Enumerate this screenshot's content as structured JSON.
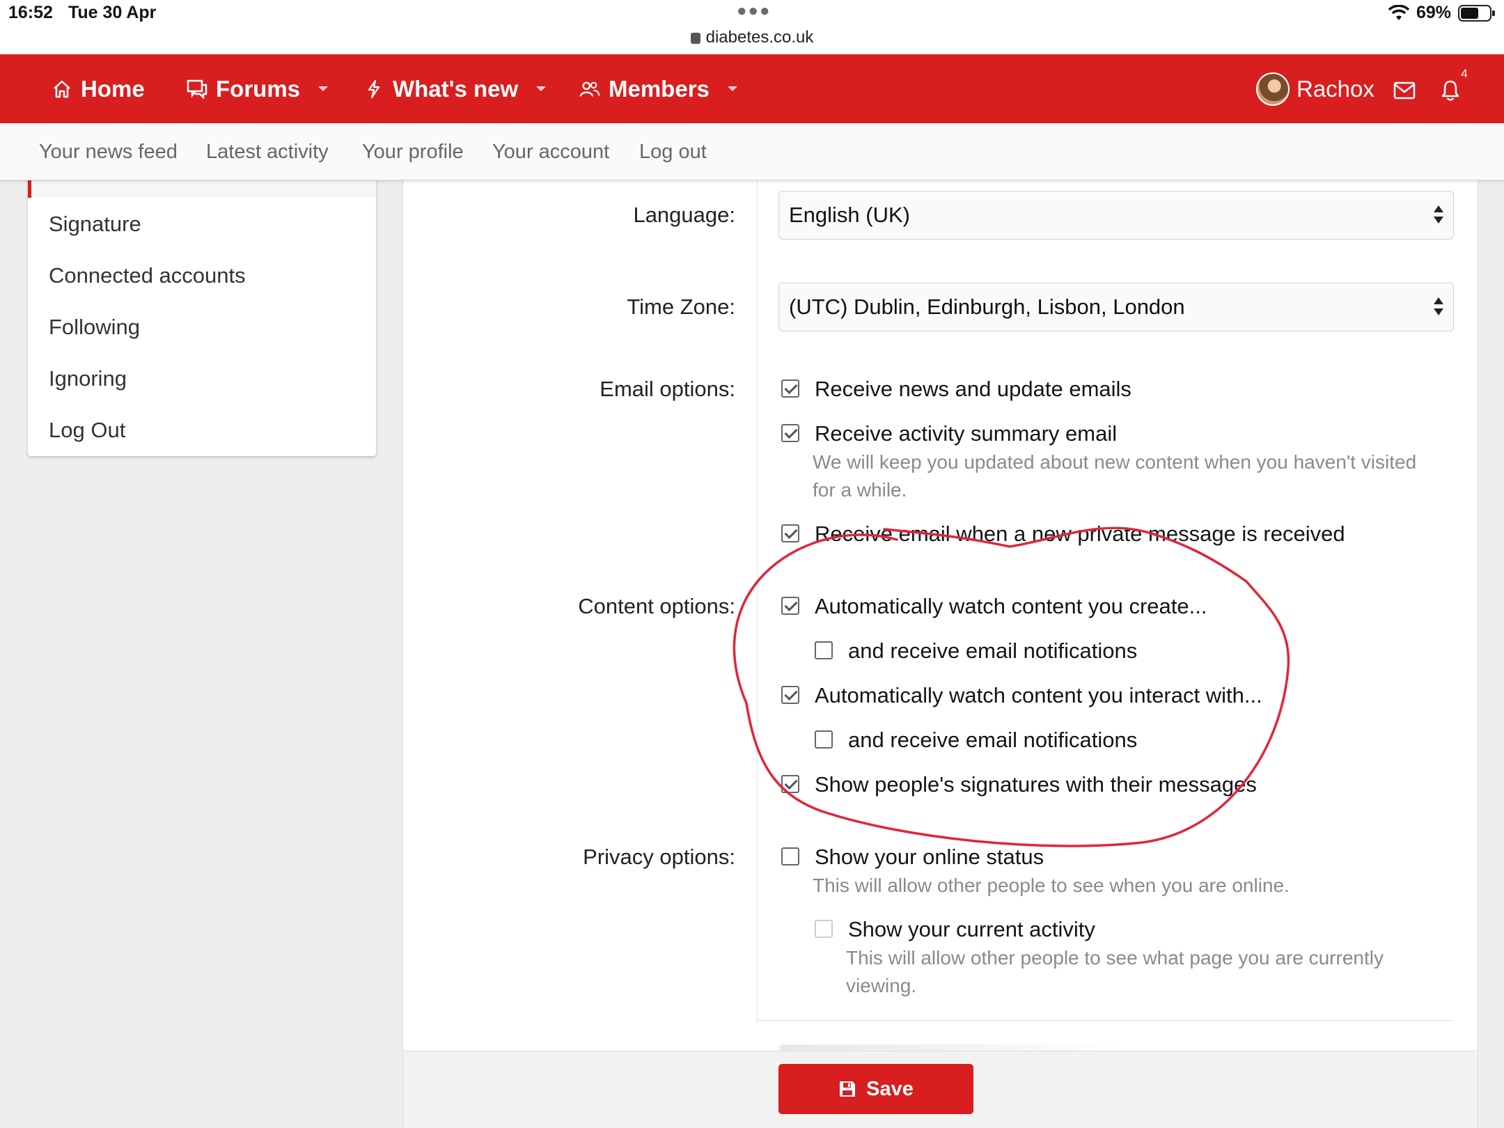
{
  "status_bar": {
    "time": "16:52",
    "date": "Tue 30 Apr",
    "url": "diabetes.co.uk",
    "battery": "69%"
  },
  "nav": {
    "items": [
      {
        "label": "Home",
        "icon": "home-icon"
      },
      {
        "label": "Forums",
        "icon": "forums-icon"
      },
      {
        "label": "What's new",
        "icon": "bolt-icon"
      },
      {
        "label": "Members",
        "icon": "members-icon"
      }
    ],
    "username": "Rachox",
    "alerts_count": "4"
  },
  "subnav": [
    "Your news feed",
    "Latest activity",
    "Your profile",
    "Your account",
    "Log out"
  ],
  "sidebar": {
    "items": [
      "Signature",
      "Connected accounts",
      "Following",
      "Ignoring",
      "Log Out"
    ]
  },
  "form": {
    "language": {
      "label": "Language:",
      "value": "English (UK)"
    },
    "timezone": {
      "label": "Time Zone:",
      "value": "(UTC) Dublin, Edinburgh, Lisbon, London"
    },
    "email": {
      "label": "Email options:",
      "options": [
        {
          "text": "Receive news and update emails",
          "checked": true
        },
        {
          "text": "Receive activity summary email",
          "checked": true,
          "hint": "We will keep you updated about new content when you haven't visited for a while."
        },
        {
          "text": "Receive email when a new private message is received",
          "checked": true
        }
      ]
    },
    "content": {
      "label": "Content options:",
      "options": [
        {
          "text": "Automatically watch content you create...",
          "checked": true
        },
        {
          "text": "and receive email notifications",
          "checked": false
        },
        {
          "text": "Automatically watch content you interact with...",
          "checked": true
        },
        {
          "text": "and receive email notifications",
          "checked": false
        },
        {
          "text": "Show people's signatures with their messages",
          "checked": true
        }
      ]
    },
    "privacy": {
      "label": "Privacy options:",
      "options": [
        {
          "text": "Show your online status",
          "checked": false,
          "hint": "This will allow other people to see when you are online."
        },
        {
          "text": "Show your current activity",
          "checked": false,
          "disabled": true,
          "hint": "This will allow other people to see what page you are currently viewing."
        }
      ]
    }
  },
  "save_label": "Save",
  "colors": {
    "brand_red": "#d81e1e",
    "annotation_red": "#e0263a"
  }
}
